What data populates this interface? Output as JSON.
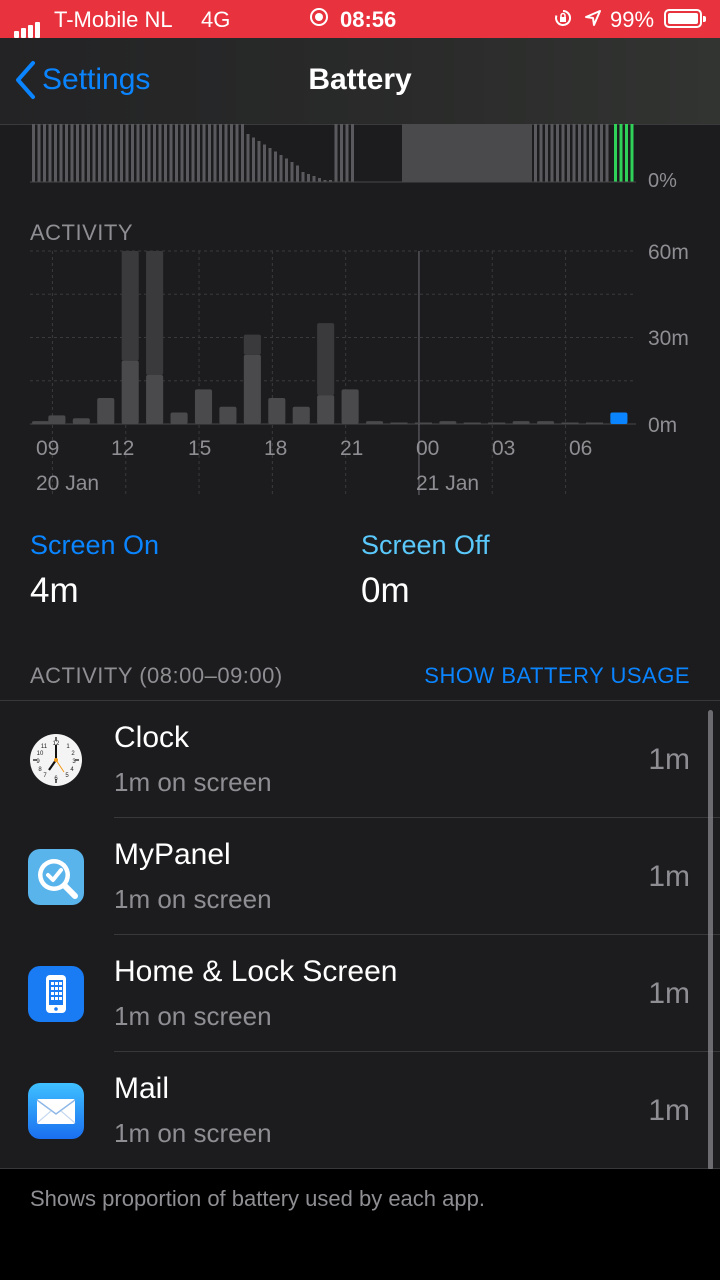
{
  "status_bar": {
    "carrier": "T-Mobile NL",
    "network": "4G",
    "time": "08:56",
    "battery_percent": "99%",
    "background_color": "#e8323d"
  },
  "nav": {
    "back_label": "Settings",
    "title": "Battery"
  },
  "battery_level_chart": {
    "min_label": "0%"
  },
  "activity_chart": {
    "label": "ACTIVITY",
    "y_labels": [
      "60m",
      "30m",
      "0m"
    ],
    "x_ticks": [
      "09",
      "12",
      "15",
      "18",
      "21",
      "00",
      "03",
      "06"
    ],
    "dates": [
      "20 Jan",
      "21 Jan"
    ]
  },
  "chart_data": {
    "type": "bar",
    "title": "ACTIVITY",
    "ylim": [
      0,
      60
    ],
    "yunit": "m",
    "categories": [
      "08",
      "09",
      "10",
      "11",
      "12",
      "13",
      "14",
      "15",
      "16",
      "17",
      "18",
      "19",
      "20",
      "21",
      "22",
      "23",
      "00",
      "01",
      "02",
      "03",
      "04",
      "05",
      "06",
      "07",
      "08"
    ],
    "series": [
      {
        "values": [
          1,
          3,
          2,
          9,
          22,
          17,
          4,
          12,
          6,
          24,
          9,
          6,
          10,
          12,
          1,
          0,
          0,
          1,
          0,
          0,
          1,
          1,
          0,
          0,
          4
        ]
      },
      {
        "values": [
          0,
          0,
          0,
          0,
          38,
          43,
          0,
          0,
          0,
          7,
          0,
          0,
          25,
          0,
          0,
          0,
          0,
          0,
          0,
          0,
          0,
          0,
          0,
          0,
          0
        ]
      }
    ],
    "highlight_color": "#0a84ff"
  },
  "stats": {
    "screen_on_label": "Screen On",
    "screen_on_value": "4m",
    "screen_off_label": "Screen Off",
    "screen_off_value": "0m"
  },
  "section": {
    "title": "ACTIVITY (08:00–09:00)",
    "action": "SHOW BATTERY USAGE"
  },
  "apps": [
    {
      "name": "Clock",
      "detail": "1m on screen",
      "duration": "1m",
      "icon": "clock-icon"
    },
    {
      "name": "MyPanel",
      "detail": "1m on screen",
      "duration": "1m",
      "icon": "mypanel-icon"
    },
    {
      "name": "Home & Lock Screen",
      "detail": "1m on screen",
      "duration": "1m",
      "icon": "home-lock-screen-icon"
    },
    {
      "name": "Mail",
      "detail": "1m on screen",
      "duration": "1m",
      "icon": "mail-icon"
    }
  ],
  "footer": {
    "text": "Shows proportion of battery used by each app."
  }
}
